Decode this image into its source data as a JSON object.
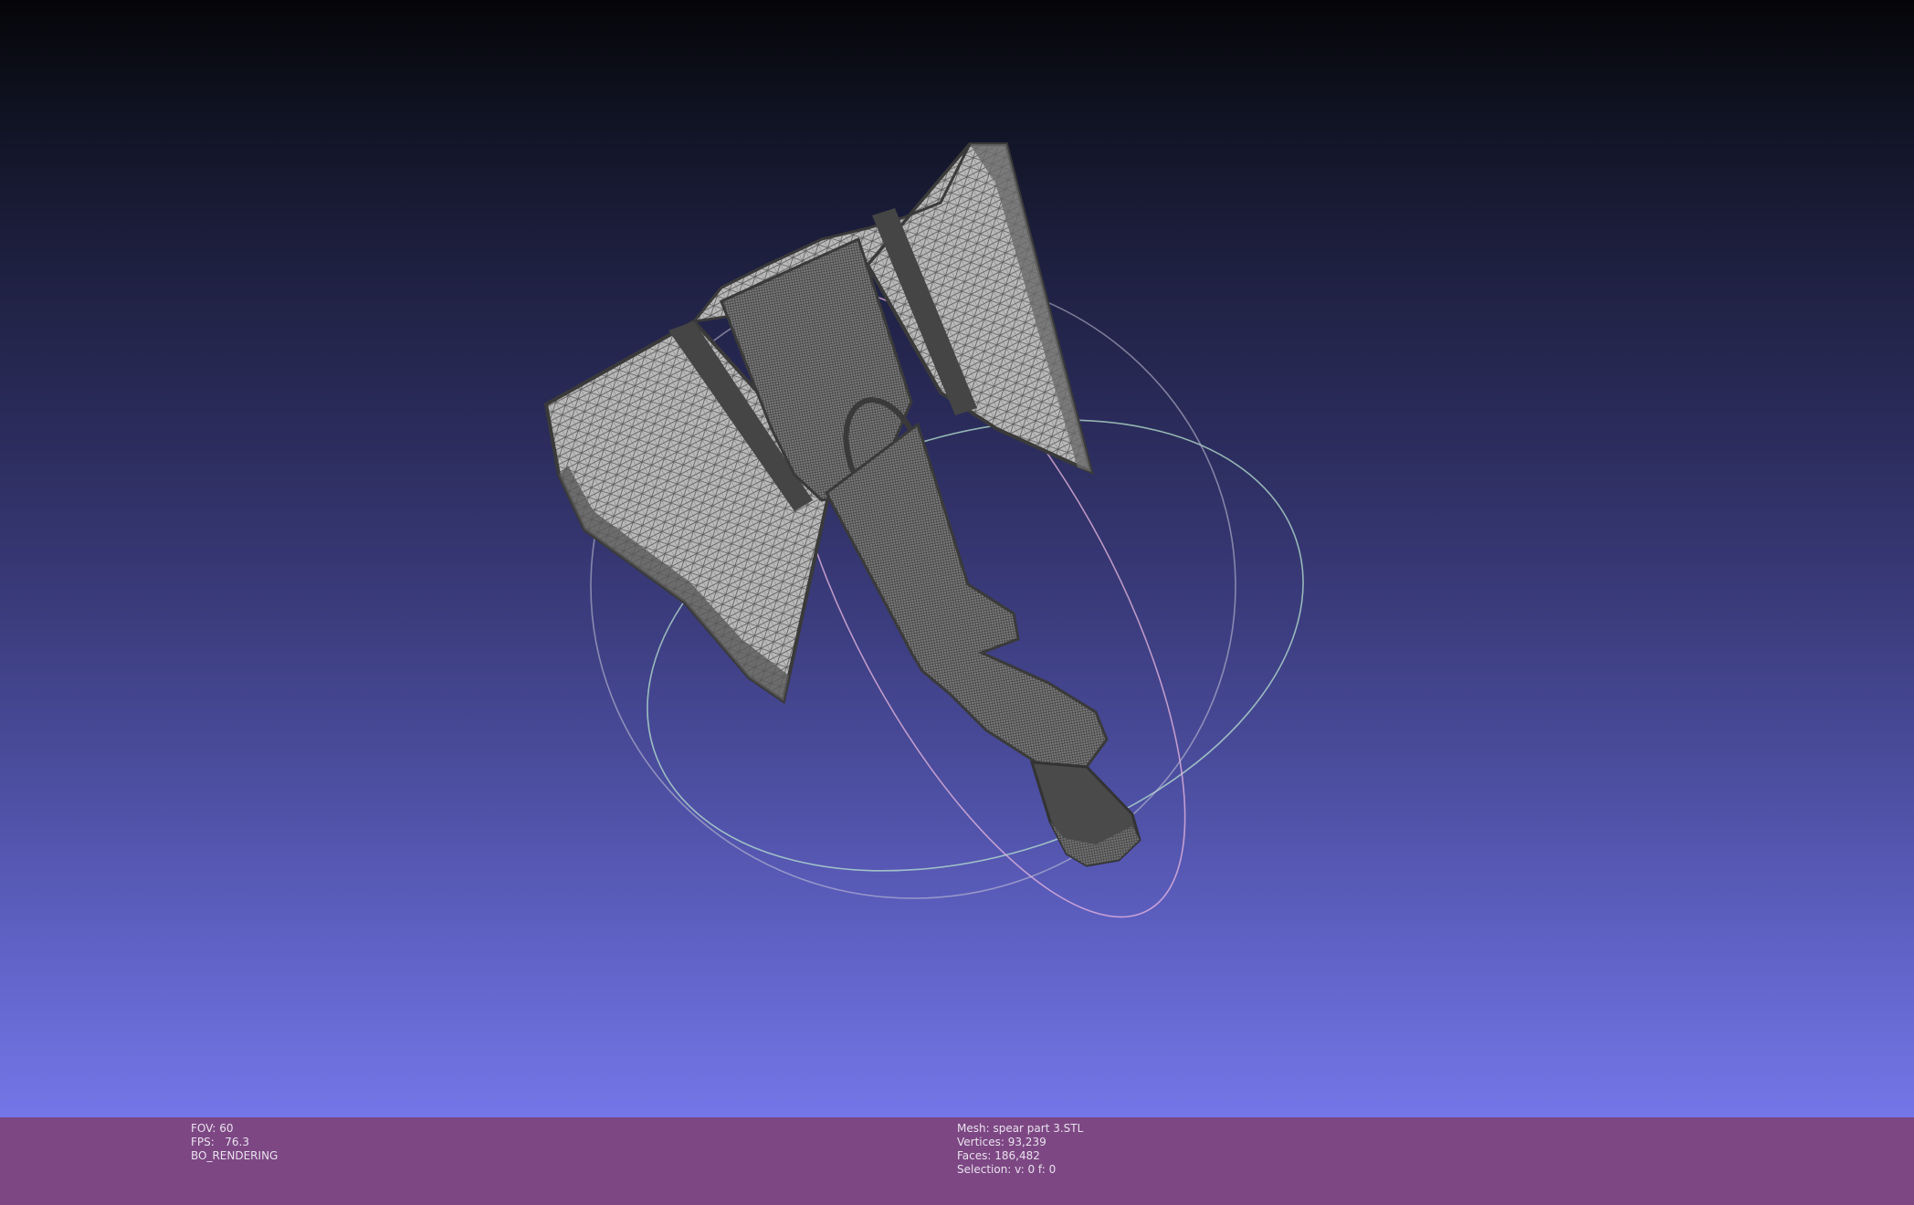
{
  "render_info": {
    "fov": "FOV: 60",
    "fps": "FPS:   76.3",
    "mode": "BO_RENDERING"
  },
  "mesh_info": {
    "mesh": "Mesh: spear part 3.STL",
    "vertices": "Vertices: 93,239",
    "faces": "Faces: 186,482",
    "selection": "Selection: v: 0 f: 0"
  },
  "colors": {
    "info_bar": "#7d4784",
    "mesh_fill": "#4a4a4a",
    "wire": "#d9d9d9"
  }
}
